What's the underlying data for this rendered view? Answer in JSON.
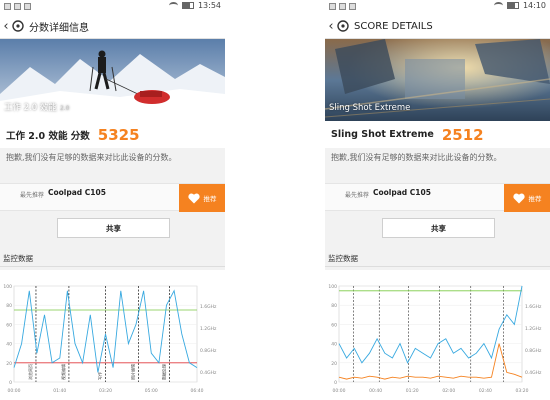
{
  "screens": [
    {
      "status_time": "13:54",
      "title": "分数详细信息",
      "hero_label": "工作 2.0 效能",
      "hero_sublabel": "2.0",
      "score_name": "工作 2.0 效能 分数",
      "score_value": "5325",
      "info_text": "抱歉,我们没有足够的数据来对比此设备的分数。",
      "device_label": "最先推荐",
      "device_name": "Coolpad C105",
      "recommend_label": "推荐",
      "share_label": "共享",
      "monitor_title": "监控数据",
      "colors": {
        "accent": "#f58220",
        "cpu_line": "#38a9e0",
        "green_line": "#7ac943",
        "red_line": "#e0393e"
      }
    },
    {
      "status_time": "14:10",
      "title": "SCORE DETAILS",
      "hero_label": "Sling Shot Extreme",
      "hero_sublabel": "",
      "score_name": "Sling Shot Extreme",
      "score_value": "2512",
      "info_text": "抱歉,我们没有足够的数据来对比此设备的分数。",
      "device_label": "最先推荐",
      "device_name": "Coolpad C105",
      "recommend_label": "推荐",
      "share_label": "共享",
      "monitor_title": "监控数据",
      "colors": {
        "accent": "#f58220",
        "cpu_line": "#38a9e0",
        "green_line": "#7ac943",
        "orange_line": "#f58220"
      }
    }
  ],
  "chart_data": [
    {
      "type": "line",
      "y_left_ticks": [
        "100",
        "80",
        "60",
        "40",
        "20",
        "0"
      ],
      "y_right_ticks": [
        "1.6GHz",
        "1.2GHz",
        "0.8GHz",
        "0.4GHz"
      ],
      "x_ticks": [
        "00:00",
        "01:40",
        "03:20",
        "05:00",
        "06:40"
      ],
      "event_labels": [
        "浏览网页",
        "视频编辑",
        "写作",
        "照片编辑",
        "数据处理"
      ],
      "series": [
        {
          "values": [
            75,
            75,
            75,
            75,
            75,
            75,
            75,
            75,
            75,
            75,
            75,
            75,
            75,
            75,
            75,
            75,
            75,
            75,
            75,
            75,
            75,
            75,
            75,
            75,
            75
          ]
        },
        {
          "values": [
            20,
            20,
            20,
            20,
            20,
            20,
            20,
            20,
            20,
            20,
            20,
            20,
            20,
            20,
            20,
            20,
            20,
            20,
            20,
            20,
            20,
            20,
            20,
            20,
            20
          ]
        },
        {
          "values": [
            15,
            40,
            95,
            30,
            70,
            20,
            25,
            95,
            40,
            20,
            70,
            10,
            50,
            15,
            95,
            40,
            60,
            95,
            30,
            20,
            80,
            95,
            50,
            20,
            15
          ]
        }
      ]
    },
    {
      "type": "line",
      "y_left_ticks": [
        "100",
        "80",
        "60",
        "40",
        "20",
        "0"
      ],
      "y_right_ticks": [
        "1.6GHz",
        "1.2GHz",
        "0.8GHz",
        "0.4GHz"
      ],
      "x_ticks": [
        "00:00",
        "00:40",
        "01:20",
        "02:00",
        "02:40",
        "03:20"
      ],
      "series": [
        {
          "values": [
            95,
            95,
            95,
            95,
            95,
            95,
            95,
            95,
            95,
            95,
            95,
            95,
            95,
            95,
            95,
            95,
            95,
            95,
            95,
            95,
            95,
            95,
            95,
            95,
            95
          ]
        },
        {
          "values": [
            40,
            25,
            35,
            20,
            30,
            45,
            30,
            25,
            40,
            20,
            35,
            30,
            25,
            40,
            45,
            30,
            35,
            25,
            30,
            40,
            25,
            55,
            70,
            60,
            100
          ]
        },
        {
          "values": [
            5,
            3,
            5,
            4,
            6,
            5,
            3,
            5,
            4,
            6,
            5,
            5,
            4,
            6,
            5,
            4,
            6,
            5,
            5,
            4,
            5,
            40,
            10,
            8,
            5
          ]
        }
      ]
    }
  ]
}
